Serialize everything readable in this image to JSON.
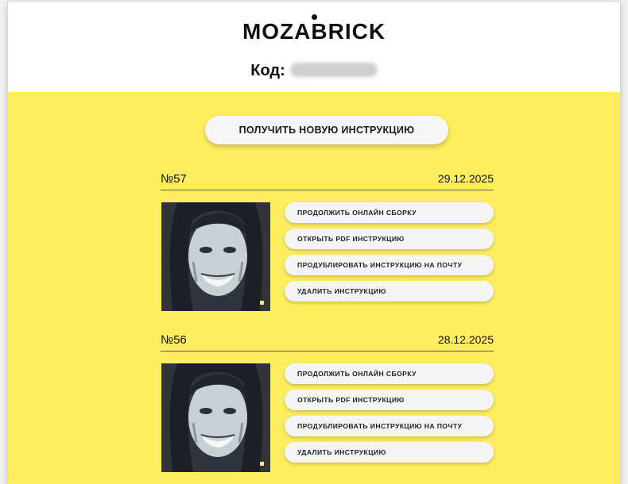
{
  "header": {
    "logo_text": "MOZABRICK",
    "code_label": "Код:"
  },
  "main": {
    "new_instruction_label": "ПОЛУЧИТЬ НОВУЮ ИНСТРУКЦИЮ",
    "instructions": [
      {
        "number": "№57",
        "date": "29.12.2025",
        "actions": [
          "ПРОДОЛЖИТЬ ОНЛАЙН СБОРКУ",
          "ОТКРЫТЬ PDF ИНСТРУКЦИЮ",
          "ПРОДУБЛИРОВАТЬ ИНСТРУКЦИЮ НА ПОЧТУ",
          "УДАЛИТЬ ИНСТРУКЦИЮ"
        ]
      },
      {
        "number": "№56",
        "date": "28.12.2025",
        "actions": [
          "ПРОДОЛЖИТЬ ОНЛАЙН СБОРКУ",
          "ОТКРЫТЬ PDF ИНСТРУКЦИЮ",
          "ПРОДУБЛИРОВАТЬ ИНСТРУКЦИЮ НА ПОЧТУ",
          "УДАЛИТЬ ИНСТРУКЦИЮ"
        ]
      }
    ]
  },
  "colors": {
    "accent_yellow": "#fded5f",
    "button_bg": "#f5f5f5",
    "mosaic_dark": "#3a3f4a",
    "mosaic_light": "#e8ecee"
  }
}
